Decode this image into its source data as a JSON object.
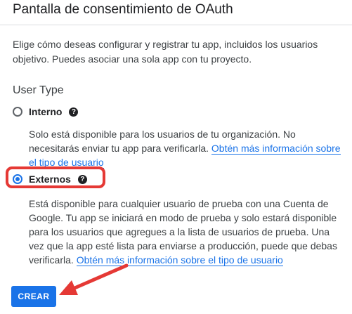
{
  "header": {
    "title": "Pantalla de consentimiento de OAuth"
  },
  "intro": "Elige cómo deseas configurar y registrar tu app, incluidos los usuarios objetivo. Puedes asociar una sola app con tu proyecto.",
  "user_type": {
    "title": "User Type",
    "options": [
      {
        "label": "Interno",
        "checked": false,
        "help_icon": "help-circle-icon",
        "description": "Solo está disponible para los usuarios de tu organización. No necesitarás enviar tu app para verificarla.",
        "link": "Obtén más información sobre el tipo de usuario"
      },
      {
        "label": "Externos",
        "checked": true,
        "help_icon": "help-circle-icon",
        "description": "Está disponible para cualquier usuario de prueba con una Cuenta de Google. Tu app se iniciará en modo de prueba y solo estará disponible para los usuarios que agregues a la lista de usuarios de prueba. Una vez que la app esté lista para enviarse a producción, puede que debas verificarla.",
        "link": "Obtén más información sobre el tipo de usuario"
      }
    ]
  },
  "create_button": {
    "label": "CREAR"
  },
  "colors": {
    "accent": "#1a73e8",
    "annotation": "#e53935"
  }
}
